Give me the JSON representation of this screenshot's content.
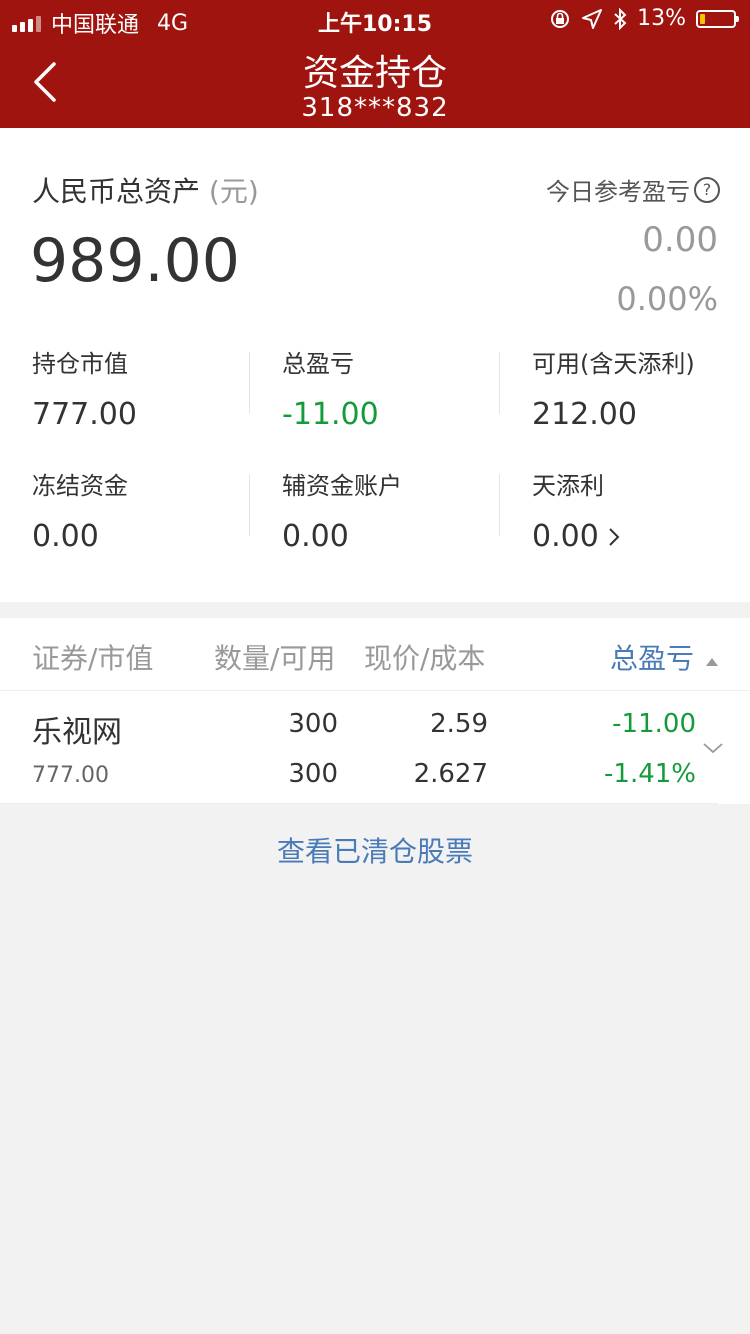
{
  "status_bar": {
    "carrier": "中国联通",
    "network": "4G",
    "time": "上午10:15",
    "battery": "13%"
  },
  "nav": {
    "title": "资金持仓",
    "account": "318***832"
  },
  "assets": {
    "title": "人民币总资产",
    "unit": "(元)",
    "total": "989.00",
    "today_label": "今日参考盈亏",
    "today_value": "0.00",
    "today_pct": "0.00%",
    "cells": [
      {
        "label": "持仓市值",
        "value": "777.00"
      },
      {
        "label": "总盈亏",
        "value": "-11.00"
      },
      {
        "label": "可用(含天添利)",
        "value": "212.00"
      },
      {
        "label": "冻结资金",
        "value": "0.00"
      },
      {
        "label": "辅资金账户",
        "value": "0.00"
      },
      {
        "label": "天添利",
        "value": "0.00"
      }
    ]
  },
  "holdings": {
    "headers": [
      "证券/市值",
      "数量/可用",
      "现价/成本",
      "总盈亏"
    ],
    "rows": [
      {
        "name": "乐视网",
        "market_value": "777.00",
        "qty": "300",
        "available": "300",
        "price": "2.59",
        "cost": "2.627",
        "pnl": "-11.00",
        "pnl_pct": "-1.41%"
      }
    ]
  },
  "cleared_link": "查看已清仓股票",
  "colors": {
    "brand": "#a0140f",
    "loss": "#139b39",
    "link": "#4a7ab8"
  }
}
